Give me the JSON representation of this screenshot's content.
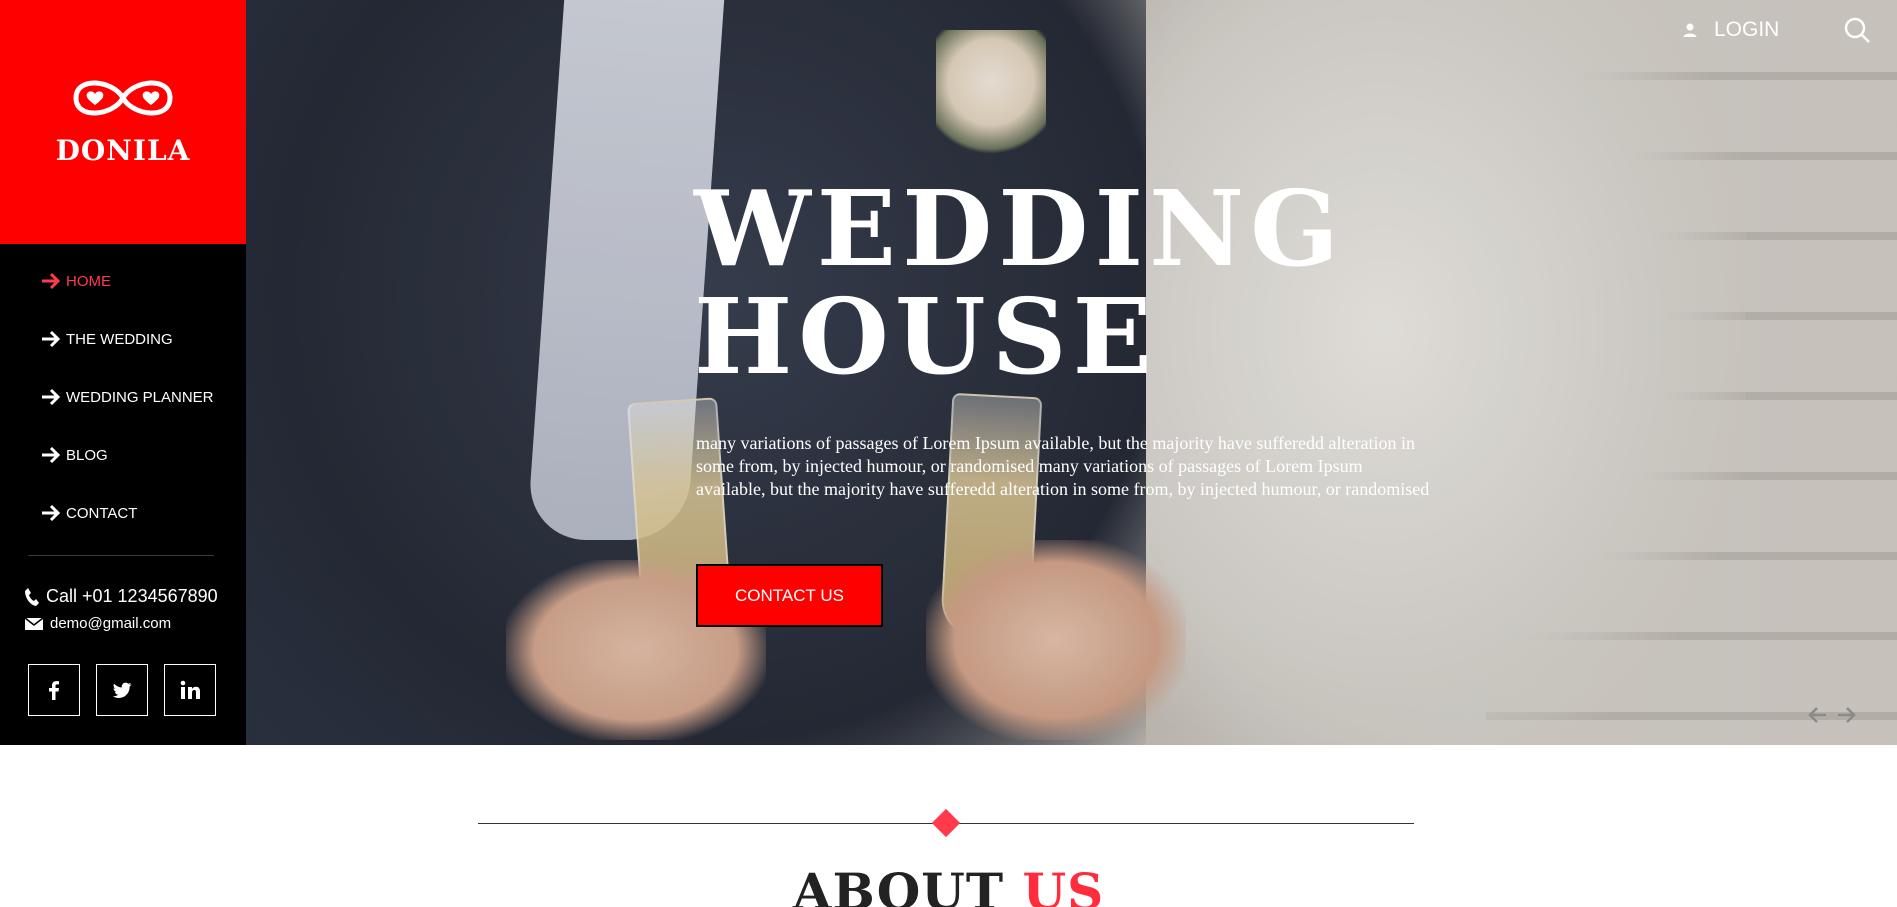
{
  "brand": {
    "name": "DONILA",
    "accent_color": "#ff0000",
    "highlight_color": "#ff3b4b"
  },
  "nav": {
    "items": [
      {
        "label": "HOME",
        "active": true,
        "icon": "arrow-right-icon"
      },
      {
        "label": "THE WEDDING",
        "active": false,
        "icon": "arrow-right-icon"
      },
      {
        "label": "WEDDING PLANNER",
        "active": false,
        "icon": "arrow-right-icon"
      },
      {
        "label": "BLOG",
        "active": false,
        "icon": "arrow-right-icon"
      },
      {
        "label": "CONTACT",
        "active": false,
        "icon": "arrow-right-icon"
      }
    ]
  },
  "contact": {
    "phone": "Call +01 1234567890",
    "email": "demo@gmail.com"
  },
  "socials": [
    {
      "icon": "facebook-icon"
    },
    {
      "icon": "twitter-icon"
    },
    {
      "icon": "linkedin-icon"
    }
  ],
  "header": {
    "login_label": "LOGIN",
    "search_icon": "search-icon",
    "user_icon": "user-icon"
  },
  "hero": {
    "title_line1": "WEDDING",
    "title_line2": "HOUSE",
    "description": "many variations of passages of Lorem Ipsum available, but the majority have sufferedd alteration in some from, by injected humour, or randomised many variations of passages of Lorem Ipsum available, but the majority have sufferedd alteration in some from, by injected humour, or randomised",
    "cta_label": "CONTACT US"
  },
  "about": {
    "title_main": "ABOUT",
    "title_accent": "US"
  }
}
